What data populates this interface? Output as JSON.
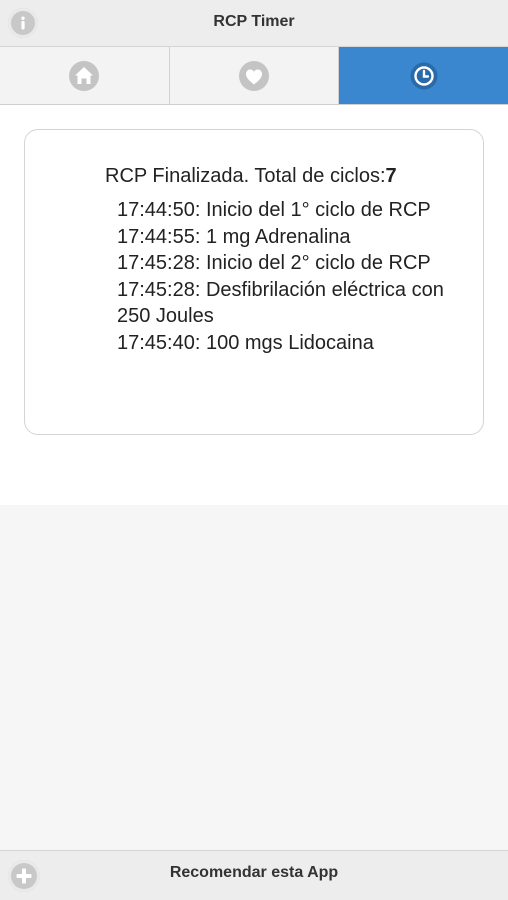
{
  "header": {
    "title": "RCP Timer",
    "info_icon": "info-icon"
  },
  "tabs": [
    {
      "icon": "home-icon",
      "active": false
    },
    {
      "icon": "heart-icon",
      "active": false
    },
    {
      "icon": "clock-icon",
      "active": true
    }
  ],
  "summary": {
    "text": "RCP Finalizada. Total de ciclos:",
    "count": "7"
  },
  "log": [
    "17:44:50: Inicio del 1° ciclo de RCP",
    "17:44:55: 1 mg Adrenalina",
    "17:45:28: Inicio del 2° ciclo de RCP",
    "17:45:28: Desfibrilación eléctrica con 250 Joules",
    "17:45:40: 100 mgs Lidocaina"
  ],
  "footer": {
    "label": "Recomendar esta App",
    "plus_icon": "plus-icon"
  },
  "colors": {
    "accent": "#3a87cf",
    "header_bg": "#ededed",
    "icon_bg": "#c8c8c8"
  }
}
